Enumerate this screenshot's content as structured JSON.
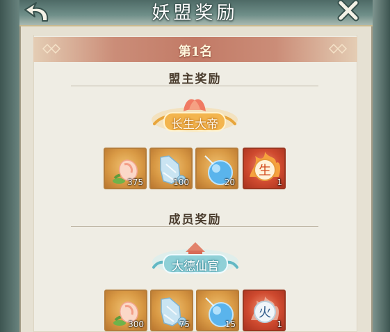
{
  "header": {
    "title": "妖盟奖励"
  },
  "rank_label": "第1名",
  "sections": [
    {
      "title": "盟主奖励",
      "badge_text": "长生大帝",
      "items": [
        {
          "icon": "peach-icon",
          "count": "375"
        },
        {
          "icon": "water-flask-icon",
          "count": "100"
        },
        {
          "icon": "spirit-orb-icon",
          "count": "20"
        },
        {
          "icon": "sheng-token-icon",
          "glyph": "生",
          "count": "1"
        }
      ]
    },
    {
      "title": "成员奖励",
      "badge_text": "大德仙官",
      "items": [
        {
          "icon": "peach-icon",
          "count": "300"
        },
        {
          "icon": "water-flask-icon",
          "count": "75"
        },
        {
          "icon": "spirit-orb-icon",
          "count": "15"
        },
        {
          "icon": "fire-token-icon",
          "glyph": "火",
          "count": "1"
        }
      ]
    }
  ],
  "colors": {
    "panel": "#efede4",
    "rank_bar": "#c27a66",
    "item_gold": "#d99a45",
    "item_red": "#cf4a2f",
    "badge_gold": "#f2b44a",
    "badge_jade": "#7fc8d0"
  }
}
